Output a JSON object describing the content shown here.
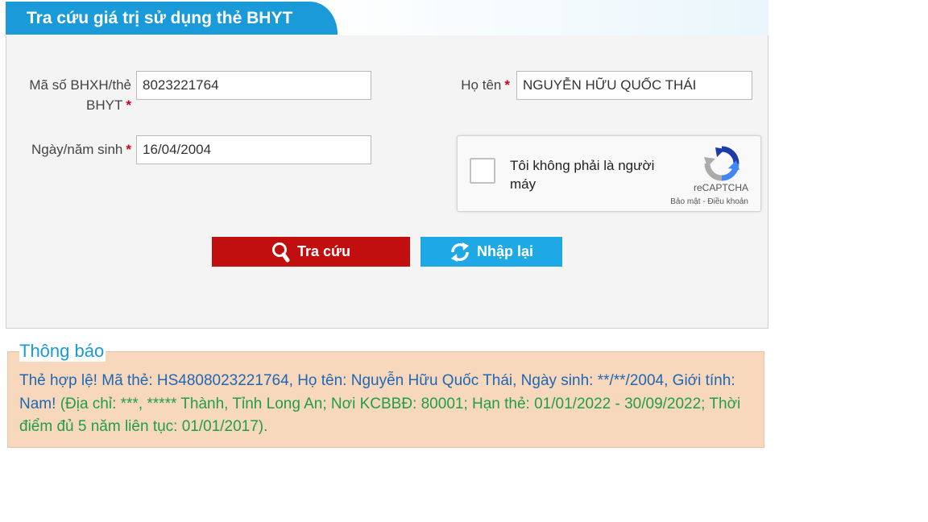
{
  "header": {
    "title": "Tra cứu giá trị sử dụng thẻ BHYT"
  },
  "form": {
    "card_label": "Mã số BHXH/thẻ BHYT",
    "card_value": "8023221764",
    "name_label": "Họ tên",
    "name_value": "NGUYỄN HỮU QUỐC THÁI",
    "dob_label": "Ngày/năm sinh",
    "dob_value": "16/04/2004",
    "required_mark": "*"
  },
  "captcha": {
    "text": "Tôi không phải là người máy",
    "brand": "reCAPTCHA",
    "privacy": "Bảo mật",
    "separator": " - ",
    "terms": "Điều khoản",
    "checked": false
  },
  "buttons": {
    "search_label": "Tra cứu",
    "reset_label": "Nhập lại",
    "search_color": "#c10e0e",
    "reset_color": "#1ea9e6"
  },
  "notice": {
    "title": "Thông báo",
    "main": "Thẻ hợp lệ! Mã thẻ: HS4808023221764, Họ tên: Nguyễn Hữu Quốc Thái, Ngày sinh: **/**/2004, Giới tính: Nam! ",
    "detail": "(Địa chỉ: ***, ***** Thành, Tỉnh Long An; Nơi KCBBĐ: 80001; Hạn thẻ: 01/01/2022 - 30/09/2022; Thời điểm đủ 5 năm liên tục: 01/01/2017)."
  },
  "colors": {
    "accent": "#1a9ad9",
    "notice_bg": "#f8d8bd",
    "notice_main": "#1e67b2",
    "notice_detail": "#1f9e47"
  }
}
